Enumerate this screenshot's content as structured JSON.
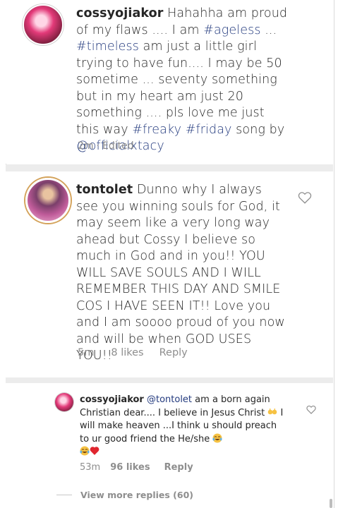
{
  "comment1": {
    "username": "cossyojiakor",
    "text_a": " Hahahha am proud of my flaws .... I am ",
    "hashtag_ageless": "#ageless",
    "text_b": " ... ",
    "hashtag_timeless": "#timeless",
    "text_c": "  am just a little girl trying to have fun.... I may be 50 sometime ... seventy something but in my heart am just 20 something .... pls love me just this way ",
    "hashtag_freaky": "#freaky",
    "text_d": " ",
    "hashtag_friday": "#friday",
    "text_e": " song by ",
    "mention": "@officialxtacy",
    "time": "2m",
    "dot": "·",
    "edited": "Edited"
  },
  "comment2": {
    "username": "tontolet",
    "text": " Dunno why I always see you winning souls for God, it may seem like a very long way ahead but Cossy I believe so much in God and in you!! YOU WILL SAVE SOULS AND I WILL REMEMBER THIS DAY AND SMILE COS I HAVE SEEN IT!! Love you and I am soooo proud of you now and will be when GOD USES YOU!!",
    "time": "5m",
    "likes": "8 likes",
    "reply": "Reply",
    "heart_icon": "heart-outline"
  },
  "reply1": {
    "username": "cossyojiakor",
    "mention": "@tontolet",
    "text_a": " am a born again Christian dear.... I believe in Jesus Christ ",
    "text_b": " I will make heaven ...I think u should preach to ur good friend the He/she ",
    "time": "53m",
    "likes": "96 likes",
    "reply": "Reply",
    "heart_icon": "heart-outline",
    "emoji_hands": "raised-hands",
    "emoji_laugh": "tears-of-joy",
    "emoji_heart": "red-heart"
  },
  "view_more": "View more replies (60)",
  "colors": {
    "hashtag": "#233a7e",
    "meta": "#8e8e8e",
    "text": "#262626",
    "separator": "#ececec"
  }
}
